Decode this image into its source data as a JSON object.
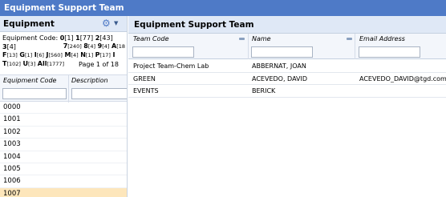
{
  "window": {
    "title": "Equipment Support Team"
  },
  "left_panel": {
    "title": "Equipment",
    "code_label": "Equipment Code:",
    "alpha_line1": [
      {
        "letter": "0",
        "count": "[1]"
      },
      {
        "letter": "1",
        "count": "[77]"
      },
      {
        "letter": "2",
        "count": "[43]"
      },
      {
        "letter": "3",
        "count": "[4]"
      }
    ],
    "alpha_line2": [
      {
        "letter": "7",
        "count": "[240]"
      },
      {
        "letter": "8",
        "count": "[4]"
      },
      {
        "letter": "9",
        "count": "[4]"
      },
      {
        "letter": "A",
        "count": "[18"
      }
    ],
    "alpha_line3": [
      {
        "letter": "F",
        "count": "[13]"
      },
      {
        "letter": "G",
        "count": "[1]"
      },
      {
        "letter": "I",
        "count": "[6]"
      },
      {
        "letter": "J",
        "count": "[560]"
      },
      {
        "letter": "M",
        "count": "[4]"
      },
      {
        "letter": "N",
        "count": "[1]"
      },
      {
        "letter": "P",
        "count": "[17]"
      },
      {
        "letter": "I",
        "count": ""
      }
    ],
    "alpha_line4": [
      {
        "letter": "T",
        "count": "[102]"
      },
      {
        "letter": "U",
        "count": "[3]"
      },
      {
        "letter": "All",
        "count": "[1777]"
      }
    ],
    "page_info": "Page 1 of 18",
    "columns": [
      "Equipment Code",
      "Description"
    ],
    "rows": [
      "0000",
      "1001",
      "1002",
      "1003",
      "1004",
      "1005",
      "1006",
      "1007"
    ],
    "selected_index": 7
  },
  "right_panel": {
    "title": "Equipment Support Team",
    "columns": [
      "Team Code",
      "Name",
      "Email Address"
    ],
    "rows": [
      {
        "team_code": "Project Team-Chem Lab",
        "name": "ABBERNAT, JOAN",
        "email": ""
      },
      {
        "team_code": "GREEN",
        "name": "ACEVEDO, DAVID",
        "email": "ACEVEDO_DAVID@tgd.com"
      },
      {
        "team_code": "EVENTS",
        "name": "BERICK",
        "email": ""
      }
    ]
  },
  "colors": {
    "titlebar": "#4e7ac7",
    "panel_header": "#dfe8f6",
    "selected_row": "#fde6bb"
  },
  "icons": {
    "settings": "gear-icon",
    "dropdown": "caret-down-icon"
  }
}
